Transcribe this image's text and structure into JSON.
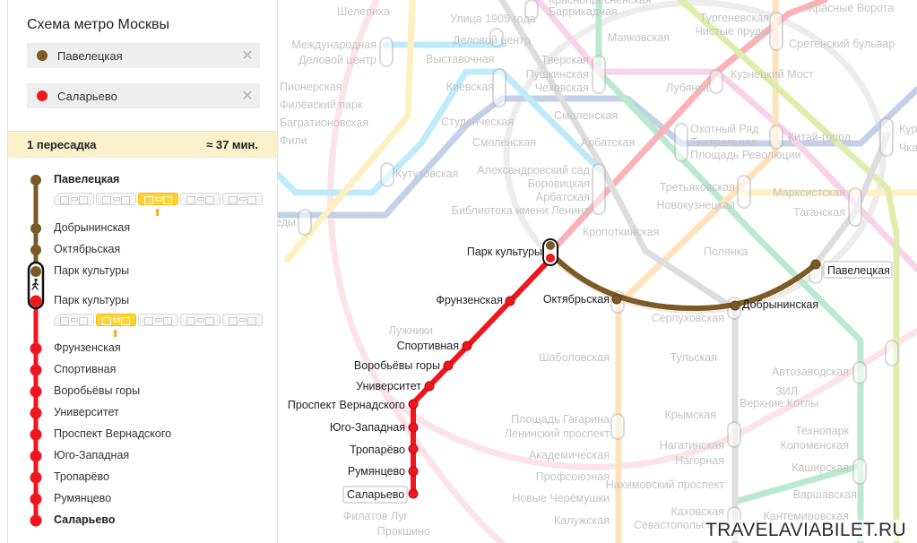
{
  "sidebar": {
    "title": "Схема метро Москвы",
    "from": {
      "value": "Павелецкая",
      "color": "#7b5a25",
      "clear_icon": "close-icon"
    },
    "to": {
      "value": "Саларьево",
      "color": "#ef161e",
      "clear_icon": "close-icon"
    },
    "summary": {
      "transfers": "1 пересадка",
      "duration": "≈ 37 мин."
    },
    "legs": [
      {
        "line_color": "#7b5a25",
        "stations": [
          "Павелецкая",
          "Добрынинская",
          "Октябрьская",
          "Парк культуры"
        ],
        "train_cars": 5,
        "recommended_car": 3
      },
      {
        "line_color": "#ef161e",
        "stations": [
          "Парк культуры",
          "Фрунзенская",
          "Спортивная",
          "Воробьёвы горы",
          "Университет",
          "Проспект Вернадского",
          "Юго-Западная",
          "Тропарёво",
          "Румянцево",
          "Саларьево"
        ],
        "train_cars": 5,
        "recommended_car": 2
      }
    ],
    "transfer_icon": "pedestrian-icon"
  },
  "map": {
    "route_labels": {
      "park_kultury": "Парк культуры",
      "oktyabrskaya": "Октябрьская",
      "dobryninskaya": "Добрынинская",
      "paveletskaya": "Павелецкая",
      "frunzenskaya": "Фрунзенская",
      "sportivnaya": "Спортивная",
      "vorobyovy_gory": "Воробьёвы горы",
      "universitet": "Университет",
      "prospekt_vernadskogo": "Проспект Вернадского",
      "yugo_zapadnaya": "Юго-Западная",
      "troparevo": "Тропарёво",
      "rumyantsevo": "Румянцево",
      "salaryevo": "Саларьево"
    },
    "background_labels": [
      "Шелепиха",
      "Улица 1905 года",
      "Краснопресненская",
      "Баррикадная",
      "Маяковская",
      "Тургеневская",
      "Чистые пруды",
      "Красные Ворота",
      "Сретенский бульвар",
      "Международная",
      "Деловой центр",
      "Деловой центр",
      "Выставочная",
      "Тверская",
      "Пушкинская",
      "Чеховская",
      "Кузнецкий Мост",
      "Лубянка",
      "Пионерская",
      "Филёвский парк",
      "Багратионовская",
      "Фили",
      "Киевская",
      "Студенческая",
      "Смоленская",
      "Смоленская",
      "Арбатская",
      "Охотный Ряд",
      "Театральная",
      "Площадь Революции",
      "Китай-город",
      "Курская",
      "Чкаловская",
      "Кутузовская",
      "Александровский сад",
      "Боровицкая",
      "Арбатская",
      "Библиотека имени Ленина",
      "Третьяковская",
      "Новокузнецкая",
      "Марксистская",
      "Таганская",
      "Кропоткинская",
      "Полянка",
      "Серпуховская",
      "Лужники",
      "Шаболовская",
      "Тульская",
      "Автозаводская",
      "ЗИЛ",
      "Верхние Котлы",
      "Крымская",
      "Площадь Гагарина",
      "Ленинский проспект",
      "Академическая",
      "Профсоюзная",
      "Технопарк",
      "Коломенская",
      "Нагатинская",
      "Нагорная",
      "Каширская",
      "Нахимовский проспект",
      "Новые Черёмушки",
      "Варшавская",
      "Каховская",
      "Калужская",
      "Кантемировская",
      "Севастопольская",
      "Филатов Луг",
      "Прокшино",
      "Победы"
    ],
    "watermark": "TRAVELAVIABILET.RU"
  }
}
